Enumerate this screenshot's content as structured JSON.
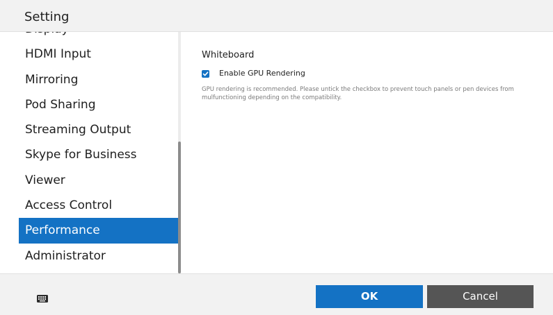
{
  "window": {
    "title": "Setting"
  },
  "sidebar": {
    "items": [
      {
        "label": "Display",
        "selected": false
      },
      {
        "label": "HDMI Input",
        "selected": false
      },
      {
        "label": "Mirroring",
        "selected": false
      },
      {
        "label": "Pod Sharing",
        "selected": false
      },
      {
        "label": "Streaming Output",
        "selected": false
      },
      {
        "label": "Skype for Business",
        "selected": false
      },
      {
        "label": "Viewer",
        "selected": false
      },
      {
        "label": "Access Control",
        "selected": false
      },
      {
        "label": "Performance",
        "selected": true
      },
      {
        "label": "Administrator",
        "selected": false
      }
    ]
  },
  "content": {
    "section_title": "Whiteboard",
    "checkbox": {
      "label": "Enable GPU Rendering",
      "checked": true
    },
    "description": "GPU rendering is recommended. Please untick the checkbox to prevent touch panels or pen devices from mulfunctioning depending on the compatibility."
  },
  "footer": {
    "keyboard_icon": "keyboard-icon",
    "ok_label": "OK",
    "cancel_label": "Cancel"
  },
  "colors": {
    "accent": "#1472c4",
    "cancel": "#555555",
    "bar_background": "#f2f2f2"
  }
}
